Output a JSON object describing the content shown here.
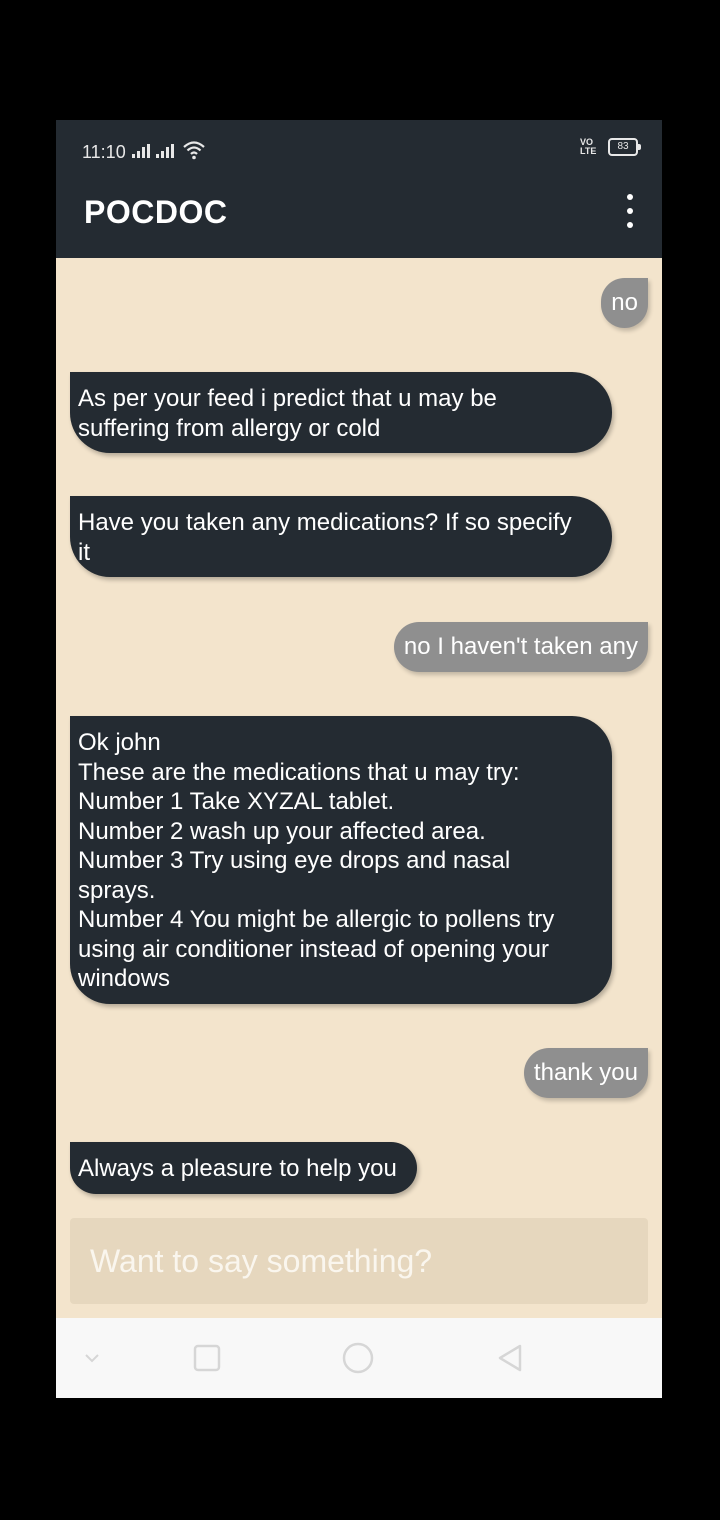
{
  "status_bar": {
    "time": "11:10",
    "battery": "83"
  },
  "app_bar": {
    "title": "POCDOC",
    "menu_icon": "more-vert-icon"
  },
  "messages": [
    {
      "sender": "user",
      "text": "no"
    },
    {
      "sender": "bot",
      "text": "As per your feed i predict that u may be\nsuffering from allergy or cold"
    },
    {
      "sender": "bot",
      "text": "Have you taken any medications? If so specify\nit"
    },
    {
      "sender": "user",
      "text": "no I haven't taken any"
    },
    {
      "sender": "bot",
      "text": "Ok john\nThese are the medications that u may try:\nNumber 1 Take XYZAL tablet.\nNumber 2 wash up your affected area.\nNumber 3 Try using eye drops and nasal\nsprays.\nNumber 4  You might be allergic to pollens try\nusing air conditioner instead of opening your\nwindows"
    },
    {
      "sender": "user",
      "text": "thank you"
    },
    {
      "sender": "bot",
      "text": "Always a pleasure to help you"
    }
  ],
  "composer": {
    "placeholder": "Want to say something?"
  },
  "colors": {
    "app_bar": "#242b32",
    "chat_background": "#f3e4cc",
    "bot_bubble": "#242b32",
    "user_bubble": "#8f8f8f"
  }
}
